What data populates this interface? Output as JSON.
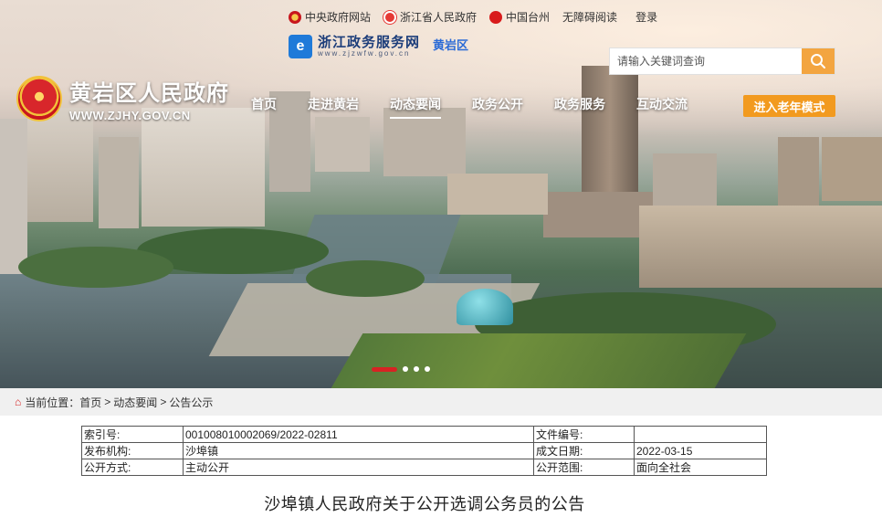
{
  "top_links": [
    {
      "label": "中央政府网站",
      "icon": "national-emblem-icon"
    },
    {
      "label": "浙江省人民政府",
      "icon": "zhejiang-logo-icon"
    },
    {
      "label": "中国台州",
      "icon": "taizhou-logo-icon"
    },
    {
      "label": "无障碍阅读"
    },
    {
      "label": "登录"
    }
  ],
  "service_portal": {
    "name": "浙江政务服务网",
    "url": "www.zjzwfw.gov.cn",
    "area": "黄岩区"
  },
  "search": {
    "placeholder": "请输入关键词查询"
  },
  "brand": {
    "name": "黄岩区人民政府",
    "url": "WWW.ZJHY.GOV.CN"
  },
  "nav": {
    "items": [
      "首页",
      "走进黄岩",
      "动态要闻",
      "政务公开",
      "政务服务",
      "互动交流"
    ],
    "active": "动态要闻",
    "elder_mode": "进入老年模式"
  },
  "slider": {
    "total": 4,
    "active": 1
  },
  "breadcrumb": {
    "prefix": "当前位置：",
    "items": [
      "首页",
      "动态要闻",
      "公告公示"
    ]
  },
  "meta_table": [
    {
      "k1": "索引号:",
      "v1": "001008010002069/2022-02811",
      "k2": "文件编号:",
      "v2": ""
    },
    {
      "k1": "发布机构:",
      "v1": "沙埠镇",
      "k2": "成文日期:",
      "v2": "2022-03-15"
    },
    {
      "k1": "公开方式:",
      "v1": "主动公开",
      "k2": "公开范围:",
      "v2": "面向全社会"
    }
  ],
  "article": {
    "title": "沙埠镇人民政府关于公开选调公务员的公告"
  },
  "colors": {
    "accent_orange": "#f29a1f",
    "accent_red": "#d72323",
    "portal_blue": "#1f7ad9"
  }
}
